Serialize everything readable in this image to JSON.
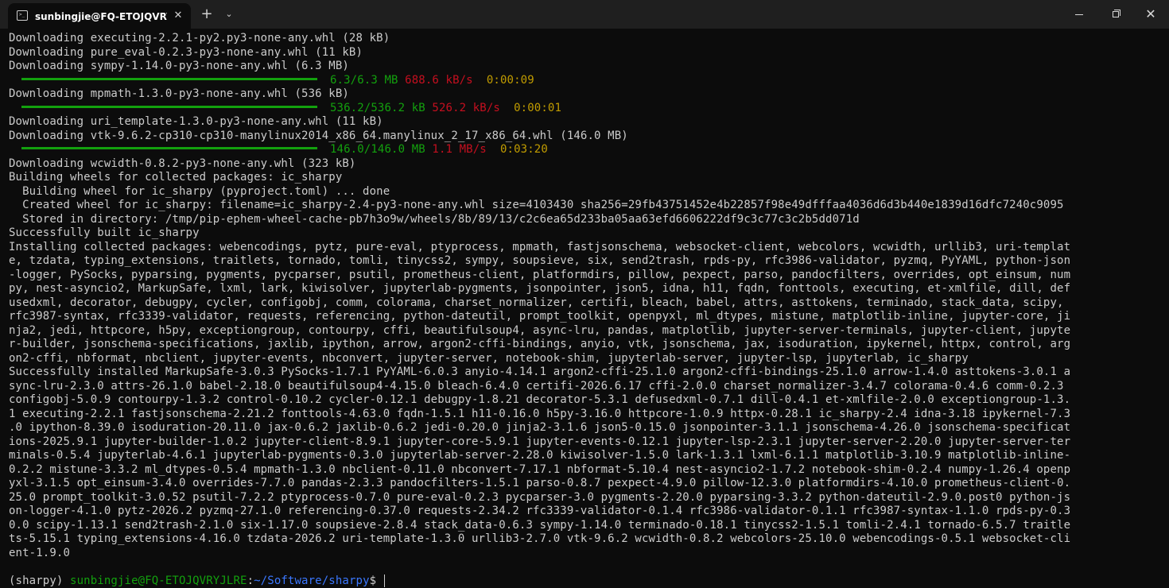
{
  "window": {
    "tab_title": "sunbingjie@FQ-ETOJQVRYJLR",
    "tab_icon": "terminal-icon",
    "close_glyph": "✕",
    "new_tab_glyph": "+",
    "dropdown_glyph": "⌄",
    "close_window_glyph": "✕"
  },
  "colors": {
    "background": "#0c0c0c",
    "text": "#cccccc",
    "green": "#13a10e",
    "red": "#c50f1f",
    "yellow": "#c19c00",
    "blue": "#3b78ff"
  },
  "terminal": {
    "lines": [
      "Downloading executing-2.2.1-py2.py3-none-any.whl (28 kB)",
      "Downloading pure_eval-0.2.3-py3-none-any.whl (11 kB)",
      "Downloading sympy-1.14.0-py3-none-any.whl (6.3 MB)",
      "Downloading mpmath-1.3.0-py3-none-any.whl (536 kB)",
      "Downloading uri_template-1.3.0-py3-none-any.whl (11 kB)",
      "Downloading vtk-9.6.2-cp310-cp310-manylinux2014_x86_64.manylinux_2_17_x86_64.whl (146.0 MB)",
      "Downloading wcwidth-0.8.2-py3-none-any.whl (323 kB)",
      "Building wheels for collected packages: ic_sharpy",
      "  Building wheel for ic_sharpy (pyproject.toml) ... done",
      "  Created wheel for ic_sharpy: filename=ic_sharpy-2.4-py3-none-any.whl size=4103430 sha256=29fb43751452e4b22857f98e49dfffaa4036d6d3b440e1839d16dfc7240c9095",
      "  Stored in directory: /tmp/pip-ephem-wheel-cache-pb7h3o9w/wheels/8b/89/13/c2c6ea65d233ba05aa63efd6606222df9c3c77c3c2b5dd071d",
      "Successfully built ic_sharpy",
      "Installing collected packages: webencodings, pytz, pure-eval, ptyprocess, mpmath, fastjsonschema, websocket-client, webcolors, wcwidth, urllib3, uri-templat",
      "e, tzdata, typing_extensions, traitlets, tornado, tomli, tinycss2, sympy, soupsieve, six, send2trash, rpds-py, rfc3986-validator, pyzmq, PyYAML, python-json",
      "-logger, PySocks, pyparsing, pygments, pycparser, psutil, prometheus-client, platformdirs, pillow, pexpect, parso, pandocfilters, overrides, opt_einsum, num",
      "py, nest-asyncio2, MarkupSafe, lxml, lark, kiwisolver, jupyterlab-pygments, jsonpointer, json5, idna, h11, fqdn, fonttools, executing, et-xmlfile, dill, def",
      "usedxml, decorator, debugpy, cycler, configobj, comm, colorama, charset_normalizer, certifi, bleach, babel, attrs, asttokens, terminado, stack_data, scipy,",
      "rfc3987-syntax, rfc3339-validator, requests, referencing, python-dateutil, prompt_toolkit, openpyxl, ml_dtypes, mistune, matplotlib-inline, jupyter-core, ji",
      "nja2, jedi, httpcore, h5py, exceptiongroup, contourpy, cffi, beautifulsoup4, async-lru, pandas, matplotlib, jupyter-server-terminals, jupyter-client, jupyte",
      "r-builder, jsonschema-specifications, jaxlib, ipython, arrow, argon2-cffi-bindings, anyio, vtk, jsonschema, jax, isoduration, ipykernel, httpx, control, arg",
      "on2-cffi, nbformat, nbclient, jupyter-events, nbconvert, jupyter-server, notebook-shim, jupyterlab-server, jupyter-lsp, jupyterlab, ic_sharpy",
      "Successfully installed MarkupSafe-3.0.3 PySocks-1.7.1 PyYAML-6.0.3 anyio-4.14.1 argon2-cffi-25.1.0 argon2-cffi-bindings-25.1.0 arrow-1.4.0 asttokens-3.0.1 a",
      "sync-lru-2.3.0 attrs-26.1.0 babel-2.18.0 beautifulsoup4-4.15.0 bleach-6.4.0 certifi-2026.6.17 cffi-2.0.0 charset_normalizer-3.4.7 colorama-0.4.6 comm-0.2.3",
      "configobj-5.0.9 contourpy-1.3.2 control-0.10.2 cycler-0.12.1 debugpy-1.8.21 decorator-5.3.1 defusedxml-0.7.1 dill-0.4.1 et-xmlfile-2.0.0 exceptiongroup-1.3.",
      "1 executing-2.2.1 fastjsonschema-2.21.2 fonttools-4.63.0 fqdn-1.5.1 h11-0.16.0 h5py-3.16.0 httpcore-1.0.9 httpx-0.28.1 ic_sharpy-2.4 idna-3.18 ipykernel-7.3",
      ".0 ipython-8.39.0 isoduration-20.11.0 jax-0.6.2 jaxlib-0.6.2 jedi-0.20.0 jinja2-3.1.6 json5-0.15.0 jsonpointer-3.1.1 jsonschema-4.26.0 jsonschema-specificat",
      "ions-2025.9.1 jupyter-builder-1.0.2 jupyter-client-8.9.1 jupyter-core-5.9.1 jupyter-events-0.12.1 jupyter-lsp-2.3.1 jupyter-server-2.20.0 jupyter-server-ter",
      "minals-0.5.4 jupyterlab-4.6.1 jupyterlab-pygments-0.3.0 jupyterlab-server-2.28.0 kiwisolver-1.5.0 lark-1.3.1 lxml-6.1.1 matplotlib-3.10.9 matplotlib-inline-",
      "0.2.2 mistune-3.3.2 ml_dtypes-0.5.4 mpmath-1.3.0 nbclient-0.11.0 nbconvert-7.17.1 nbformat-5.10.4 nest-asyncio2-1.7.2 notebook-shim-0.2.4 numpy-1.26.4 openp",
      "yxl-3.1.5 opt_einsum-3.4.0 overrides-7.7.0 pandas-2.3.3 pandocfilters-1.5.1 parso-0.8.7 pexpect-4.9.0 pillow-12.3.0 platformdirs-4.10.0 prometheus-client-0.",
      "25.0 prompt_toolkit-3.0.52 psutil-7.2.2 ptyprocess-0.7.0 pure-eval-0.2.3 pycparser-3.0 pygments-2.20.0 pyparsing-3.3.2 python-dateutil-2.9.0.post0 python-js",
      "on-logger-4.1.0 pytz-2026.2 pyzmq-27.1.0 referencing-0.37.0 requests-2.34.2 rfc3339-validator-0.1.4 rfc3986-validator-0.1.1 rfc3987-syntax-1.1.0 rpds-py-0.3",
      "0.0 scipy-1.13.1 send2trash-2.1.0 six-1.17.0 soupsieve-2.8.4 stack_data-0.6.3 sympy-1.14.0 terminado-0.18.1 tinycss2-1.5.1 tomli-2.4.1 tornado-6.5.7 traitle",
      "ts-5.15.1 typing_extensions-4.16.0 tzdata-2026.2 uri-template-1.3.0 urllib3-2.7.0 vtk-9.6.2 wcwidth-0.8.2 webcolors-25.10.0 webencodings-0.5.1 websocket-cli",
      "ent-1.9.0"
    ],
    "progress": [
      {
        "size": "6.3/6.3 MB",
        "speed": "688.6 kB/s",
        "eta": "0:00:09",
        "fraction": 1.0
      },
      {
        "size": "536.2/536.2 kB",
        "speed": "526.2 kB/s",
        "eta": "0:00:01",
        "fraction": 1.0
      },
      {
        "size": "146.0/146.0 MB",
        "speed": "1.1 MB/s",
        "eta": "0:03:20",
        "fraction": 1.0
      }
    ],
    "prompt": {
      "env": "(sharpy)",
      "user_host": "sunbingjie@FQ-ETOJQVRYJLRE",
      "path": "~/Software/sharpy",
      "symbol": "$"
    }
  }
}
